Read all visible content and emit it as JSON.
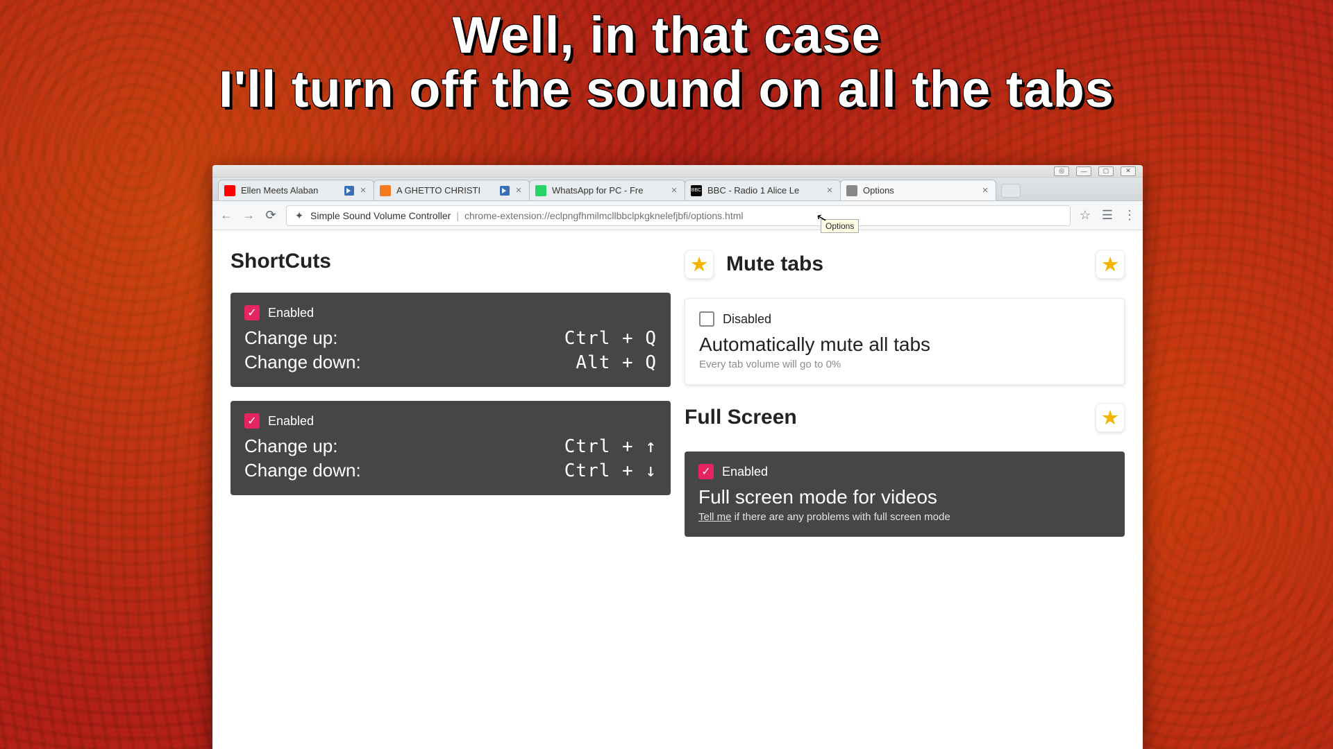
{
  "headline_line1": "Well, in that case",
  "headline_line2": "I'll turn off the sound on all the tabs",
  "tabs": [
    {
      "title": "Ellen Meets Alaban",
      "favicon": "youtube",
      "audio": true
    },
    {
      "title": "A GHETTO CHRISTI",
      "favicon": "orange",
      "audio": true
    },
    {
      "title": "WhatsApp for PC - Fre",
      "favicon": "green",
      "audio": false
    },
    {
      "title": "BBC - Radio 1 Alice Le",
      "favicon": "bbc",
      "audio": false
    },
    {
      "title": "Options",
      "favicon": "ext",
      "audio": false,
      "active": true
    }
  ],
  "omnibox": {
    "page_name": "Simple Sound Volume Controller",
    "url": "chrome-extension://eclpngfhmilmcllbbclpkgknelefjbfi/options.html"
  },
  "tooltip": "Options",
  "sections": {
    "shortcuts": {
      "title": "ShortCuts"
    },
    "mutetabs": {
      "title": "Mute tabs"
    },
    "fullscreen": {
      "title": "Full Screen"
    }
  },
  "cards": {
    "sc1": {
      "enabled": true,
      "enabled_label": "Enabled",
      "rows": [
        {
          "label": "Change up:",
          "value": "Ctrl + Q"
        },
        {
          "label": "Change down:",
          "value": "Alt + Q"
        }
      ]
    },
    "sc2": {
      "enabled": true,
      "enabled_label": "Enabled",
      "rows": [
        {
          "label": "Change up:",
          "value": "Ctrl + ↑"
        },
        {
          "label": "Change down:",
          "value": "Ctrl + ↓"
        }
      ]
    },
    "mute": {
      "enabled": false,
      "enabled_label": "Disabled",
      "title": "Automatically mute all tabs",
      "sub": "Every tab volume will go to 0%"
    },
    "fs": {
      "enabled": true,
      "enabled_label": "Enabled",
      "title": "Full screen mode for videos",
      "sub_link": "Tell me",
      "sub_rest": " if there are any problems with full screen mode"
    }
  }
}
